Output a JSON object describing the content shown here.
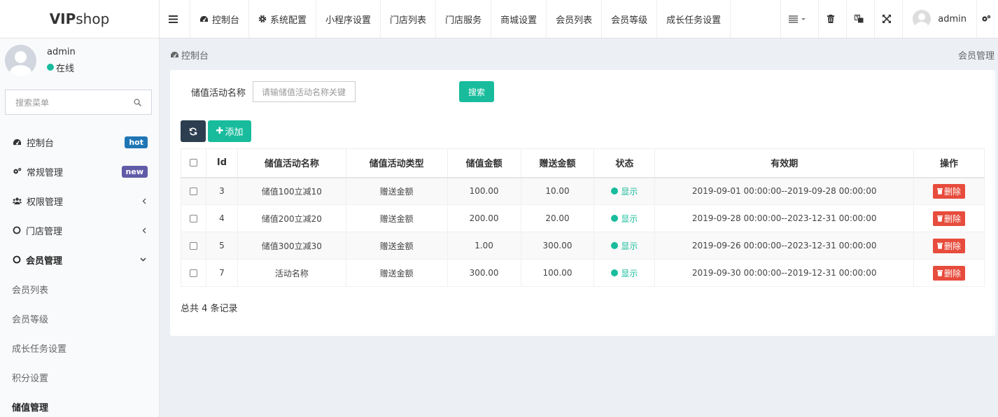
{
  "logo": {
    "bold": "VIP",
    "rest": "shop"
  },
  "topnav": {
    "items": [
      {
        "label": "控制台",
        "icon": "dashboard-icon"
      },
      {
        "label": "系统配置",
        "icon": "gear-icon"
      },
      {
        "label": "小程序设置"
      },
      {
        "label": "门店列表"
      },
      {
        "label": "门店服务"
      },
      {
        "label": "商城设置"
      },
      {
        "label": "会员列表"
      },
      {
        "label": "会员等级"
      },
      {
        "label": "成长任务设置"
      }
    ],
    "user": "admin"
  },
  "sidebar": {
    "user": {
      "name": "admin",
      "status": "在线"
    },
    "search_placeholder": "搜索菜单",
    "items": [
      {
        "label": "控制台",
        "badge": "hot"
      },
      {
        "label": "常规管理",
        "badge": "new"
      },
      {
        "label": "权限管理"
      },
      {
        "label": "门店管理"
      },
      {
        "label": "会员管理"
      }
    ],
    "sub_items": [
      "会员列表",
      "会员等级",
      "成长任务设置",
      "积分设置",
      "储值管理"
    ]
  },
  "breadcrumb": {
    "left": "控制台",
    "right": "会员管理"
  },
  "filter": {
    "label": "储值活动名称",
    "placeholder": "请输储值活动名称关键",
    "search_button": "搜索"
  },
  "toolbar": {
    "add_label": "添加"
  },
  "table": {
    "headers": [
      "Id",
      "储值活动名称",
      "储值活动类型",
      "储值金额",
      "赠送金额",
      "状态",
      "有效期",
      "操作"
    ],
    "rows": [
      {
        "id": "3",
        "name": "储值100立减10",
        "type": "赠送金额",
        "amount": "100.00",
        "gift": "10.00",
        "status": "显示",
        "period": "2019-09-01 00:00:00--2019-09-28 00:00:00",
        "action": "删除"
      },
      {
        "id": "4",
        "name": "储值200立减20",
        "type": "赠送金额",
        "amount": "200.00",
        "gift": "20.00",
        "status": "显示",
        "period": "2019-09-28 00:00:00--2023-12-31 00:00:00",
        "action": "删除"
      },
      {
        "id": "5",
        "name": "储值300立减30",
        "type": "赠送金额",
        "amount": "1.00",
        "gift": "300.00",
        "status": "显示",
        "period": "2019-09-26 00:00:00--2023-12-31 00:00:00",
        "action": "删除"
      },
      {
        "id": "7",
        "name": "活动名称",
        "type": "赠送金额",
        "amount": "300.00",
        "gift": "100.00",
        "status": "显示",
        "period": "2019-09-30 00:00:00--2019-12-31 00:00:00",
        "action": "删除"
      }
    ],
    "total": "总共 4 条记录"
  },
  "colors": {
    "primary": "#18bc9c",
    "dark": "#2c3e50",
    "danger": "#e74c3c",
    "hot": "#1f76b5",
    "new": "#605ca8"
  }
}
